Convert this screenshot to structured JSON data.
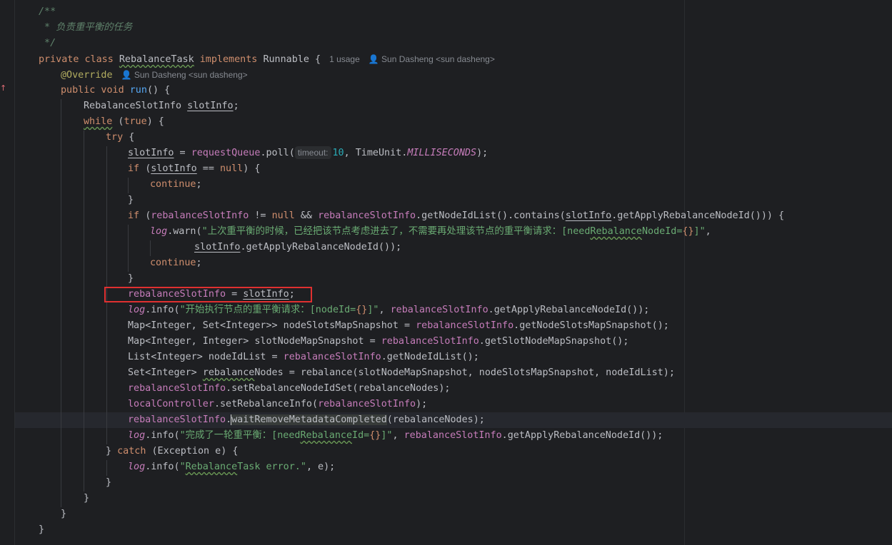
{
  "editor": {
    "comment_open": "/**",
    "comment_text": " * 负责重平衡的任务",
    "comment_close": " */",
    "usage_hint": "1 usage",
    "author_hint": "Sun Dasheng <sun dasheng>",
    "param_hint_timeout": "timeout:",
    "class_name": "RebalanceTask",
    "colors": {
      "background": "#1e1f22",
      "keyword": "#cf8e6d",
      "string": "#6aab73",
      "field": "#c77dbb",
      "function": "#56a8f5",
      "highlight_box": "#e03030"
    }
  }
}
